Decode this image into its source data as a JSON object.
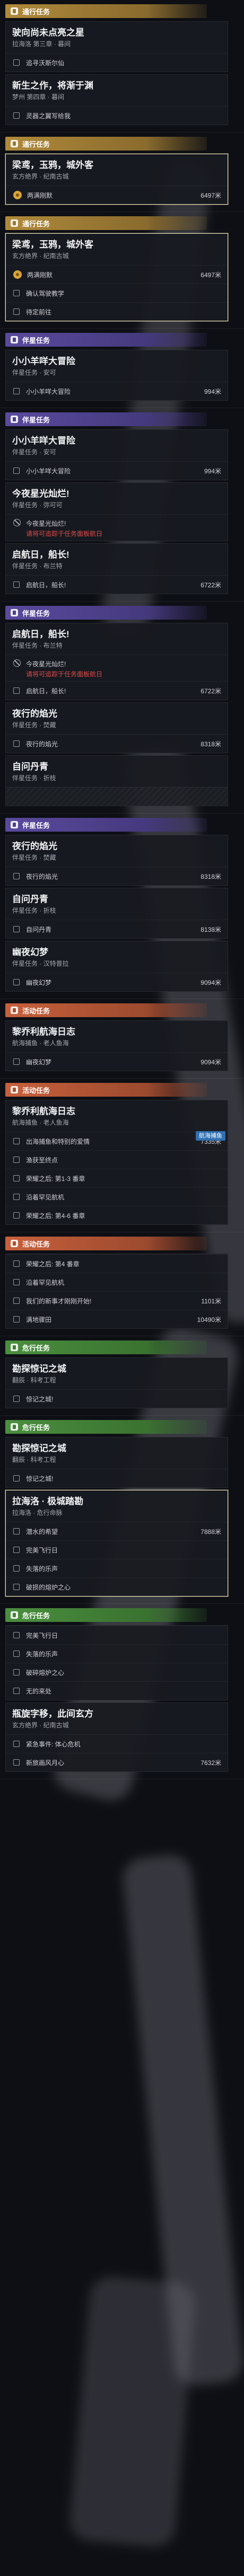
{
  "screen": "quest-tracker",
  "colors": {
    "common": "#b08a3a",
    "companion": "#5a4a9e",
    "event": "#c8603c",
    "danger": "#4a8f3e",
    "warning_text": "#e14b4b",
    "selected_border": "#e7d9b0",
    "tag": "#2f6fb0"
  },
  "icons": {
    "task": "checkbox-icon",
    "locked": "no-entry-icon",
    "tracked": "coin-marker-icon",
    "section": "scroll-icon"
  },
  "frames": [
    {
      "section": {
        "style": "common",
        "label": "通行任务"
      },
      "cards": [
        {
          "title": "驶向尚未点亮之星",
          "sub": "拉海洛 第三章 · 暮间",
          "tasks": [
            {
              "icon": "cb",
              "text": "追寻沃斯尔仙",
              "dist": ""
            }
          ]
        },
        {
          "title": "新生之作，将渐于渊",
          "sub": "梦州 第四章 · 暮间",
          "tasks": [
            {
              "icon": "cb",
              "text": "灵器之翼写给我",
              "dist": ""
            }
          ]
        }
      ]
    },
    {
      "section": {
        "style": "common",
        "label": "通行任务"
      },
      "cards": [
        {
          "selected": true,
          "title": "梁鸢，玉鸦，城外客",
          "sub": "玄方绝界 · 纪南古城",
          "tasks": [
            {
              "icon": "coin",
              "text": "两满刚默",
              "dist": "6497米"
            }
          ]
        }
      ]
    },
    {
      "section": {
        "style": "common",
        "label": "通行任务"
      },
      "cards": [
        {
          "selected": true,
          "title": "梁鸢，玉鸦，城外客",
          "sub": "玄方绝界 · 纪南古城",
          "tasks": [
            {
              "icon": "coin",
              "text": "两满刚默",
              "dist": "6497米"
            },
            {
              "icon": "cb",
              "text": "确认驾驶教学",
              "dist": ""
            },
            {
              "icon": "cb",
              "text": "待定前往",
              "dist": ""
            }
          ]
        }
      ]
    },
    {
      "section": {
        "style": "companion",
        "label": "伴星任务"
      },
      "cards": [
        {
          "title": "小小羊咩大冒险",
          "sub": "伴星任务 · 安可",
          "tasks": [
            {
              "icon": "cb",
              "text": "小小羊咩大冒险",
              "dist": "994米"
            }
          ]
        }
      ]
    },
    {
      "section": {
        "style": "companion",
        "label": "伴星任务"
      },
      "cards": [
        {
          "title": "小小羊咩大冒险",
          "sub": "伴星任务 · 安可",
          "tasks": [
            {
              "icon": "cb",
              "text": "小小羊咩大冒险",
              "dist": "994米"
            }
          ]
        },
        {
          "title": "今夜星光灿烂!",
          "sub": "伴星任务 · 弥可可",
          "tasks": [
            {
              "icon": "ban",
              "text": "今夜星光灿烂!",
              "warn": "请将可追踪于任务面板航日",
              "dist": ""
            }
          ]
        },
        {
          "title": "启航日，船长!",
          "sub": "伴星任务 · 布兰特",
          "tasks": [
            {
              "icon": "cb",
              "text": "启航日，船长!",
              "dist": "6722米"
            }
          ]
        }
      ]
    },
    {
      "section": {
        "style": "companion",
        "label": "伴星任务"
      },
      "cards": [
        {
          "title": "启航日，船长!",
          "sub": "伴星任务 · 布兰特",
          "tasks": [
            {
              "icon": "ban",
              "text": "今夜星光灿烂!",
              "warn": "请将可追踪于任务面板航日",
              "dist": ""
            },
            {
              "icon": "cb",
              "text": "启航日，船长!",
              "dist": "6722米"
            }
          ]
        },
        {
          "title": "夜行的焰光",
          "sub": "伴星任务 · 焚藏",
          "tasks": [
            {
              "icon": "cb",
              "text": "夜行的焰光",
              "dist": "8318米"
            }
          ]
        },
        {
          "title": "自问丹青",
          "sub": "伴星任务 · 折枝",
          "tasks": []
        }
      ]
    },
    {
      "section": {
        "style": "companion",
        "label": "伴星任务"
      },
      "cards": [
        {
          "title": "夜行的焰光",
          "sub": "伴星任务 · 焚藏",
          "tasks": [
            {
              "icon": "cb",
              "text": "夜行的焰光",
              "dist": "8318米"
            }
          ]
        },
        {
          "title": "自问丹青",
          "sub": "伴星任务 · 折枝",
          "tasks": [
            {
              "icon": "cb",
              "text": "自问丹青",
              "dist": "8138米"
            }
          ]
        },
        {
          "title": "幽夜幻梦",
          "sub": "伴星任务 · 汉特普拉",
          "tasks": [
            {
              "icon": "cb",
              "text": "幽夜幻梦",
              "dist": "9094米"
            }
          ]
        }
      ]
    },
    {
      "section": {
        "style": "event",
        "label": "活动任务"
      },
      "cards": [
        {
          "title": "黎乔利航海日志",
          "sub": "航海捕鱼 · 老人鱼海",
          "tasks": [
            {
              "icon": "cb",
              "text": "幽夜幻梦",
              "dist": "9094米"
            }
          ]
        }
      ]
    },
    {
      "section": {
        "style": "event",
        "label": "活动任务"
      },
      "cards": [
        {
          "title": "黎乔利航海日志",
          "sub": "航海捕鱼 · 老人鱼海",
          "tag": "航海捕鱼",
          "tasks": [
            {
              "icon": "cb",
              "text": "出海捕鱼和特别的爱情",
              "dist": "7335米"
            },
            {
              "icon": "cb",
              "text": "渔获至终点",
              "dist": ""
            },
            {
              "icon": "cb",
              "text": "荣耀之后: 第1-3 番章",
              "dist": ""
            },
            {
              "icon": "cb",
              "text": "沿着罕见航机",
              "dist": ""
            },
            {
              "icon": "cb",
              "text": "荣耀之后: 第4-6 番章",
              "dist": ""
            }
          ]
        }
      ]
    },
    {
      "section": {
        "style": "event",
        "label": "活动任务"
      },
      "cards": [
        {
          "title": "",
          "sub": "",
          "tasks": [
            {
              "icon": "cb",
              "text": "荣耀之后: 第4 番章",
              "dist": ""
            },
            {
              "icon": "cb",
              "text": "沿着罕见航机",
              "dist": ""
            },
            {
              "icon": "cb",
              "text": "我们的新事才刚刚开始!",
              "dist": "1101米"
            },
            {
              "icon": "cb",
              "text": "满地骤田",
              "dist": "10490米"
            }
          ]
        }
      ]
    },
    {
      "section": {
        "style": "danger",
        "label": "危行任务"
      },
      "cards": [
        {
          "title": "勘探惊记之城",
          "sub": "翻辰 · 科考工程",
          "tasks": [
            {
              "icon": "cb",
              "text": "惊记之城!",
              "dist": ""
            }
          ]
        }
      ]
    },
    {
      "section": {
        "style": "danger",
        "label": "危行任务"
      },
      "cards": [
        {
          "title": "勘探惊记之城",
          "sub": "翻辰 · 科考工程",
          "tasks": [
            {
              "icon": "cb",
              "text": "惊记之城!",
              "dist": ""
            }
          ]
        },
        {
          "selected": true,
          "title": "拉海洛 · 极城踏勘",
          "sub": "拉海洛 · 危行命脉",
          "tasks": [
            {
              "icon": "cb",
              "text": "潜水的希望",
              "dist": "7888米"
            },
            {
              "icon": "cb",
              "text": "完美飞行日",
              "dist": ""
            },
            {
              "icon": "cb",
              "text": "失落的乐声",
              "dist": ""
            },
            {
              "icon": "cb",
              "text": "破损的熔炉之心",
              "dist": ""
            }
          ]
        }
      ]
    },
    {
      "section": {
        "style": "danger",
        "label": "危行任务"
      },
      "cards": [
        {
          "title": "",
          "sub": "",
          "tasks": [
            {
              "icon": "cb",
              "text": "完美飞行日",
              "dist": ""
            },
            {
              "icon": "cb",
              "text": "失落的乐声",
              "dist": ""
            },
            {
              "icon": "cb",
              "text": "破碎熔炉之心",
              "dist": ""
            },
            {
              "icon": "cb",
              "text": "无的来处",
              "dist": ""
            }
          ]
        },
        {
          "title": "瓶旋字移，此间玄方",
          "sub": "玄方绝界 · 纪南古城",
          "tasks": [
            {
              "icon": "cb",
              "text": "紧急事件: 体心危机",
              "dist": ""
            },
            {
              "icon": "cb",
              "text": "新旅画风月心",
              "dist": "7632米"
            }
          ]
        }
      ]
    }
  ]
}
